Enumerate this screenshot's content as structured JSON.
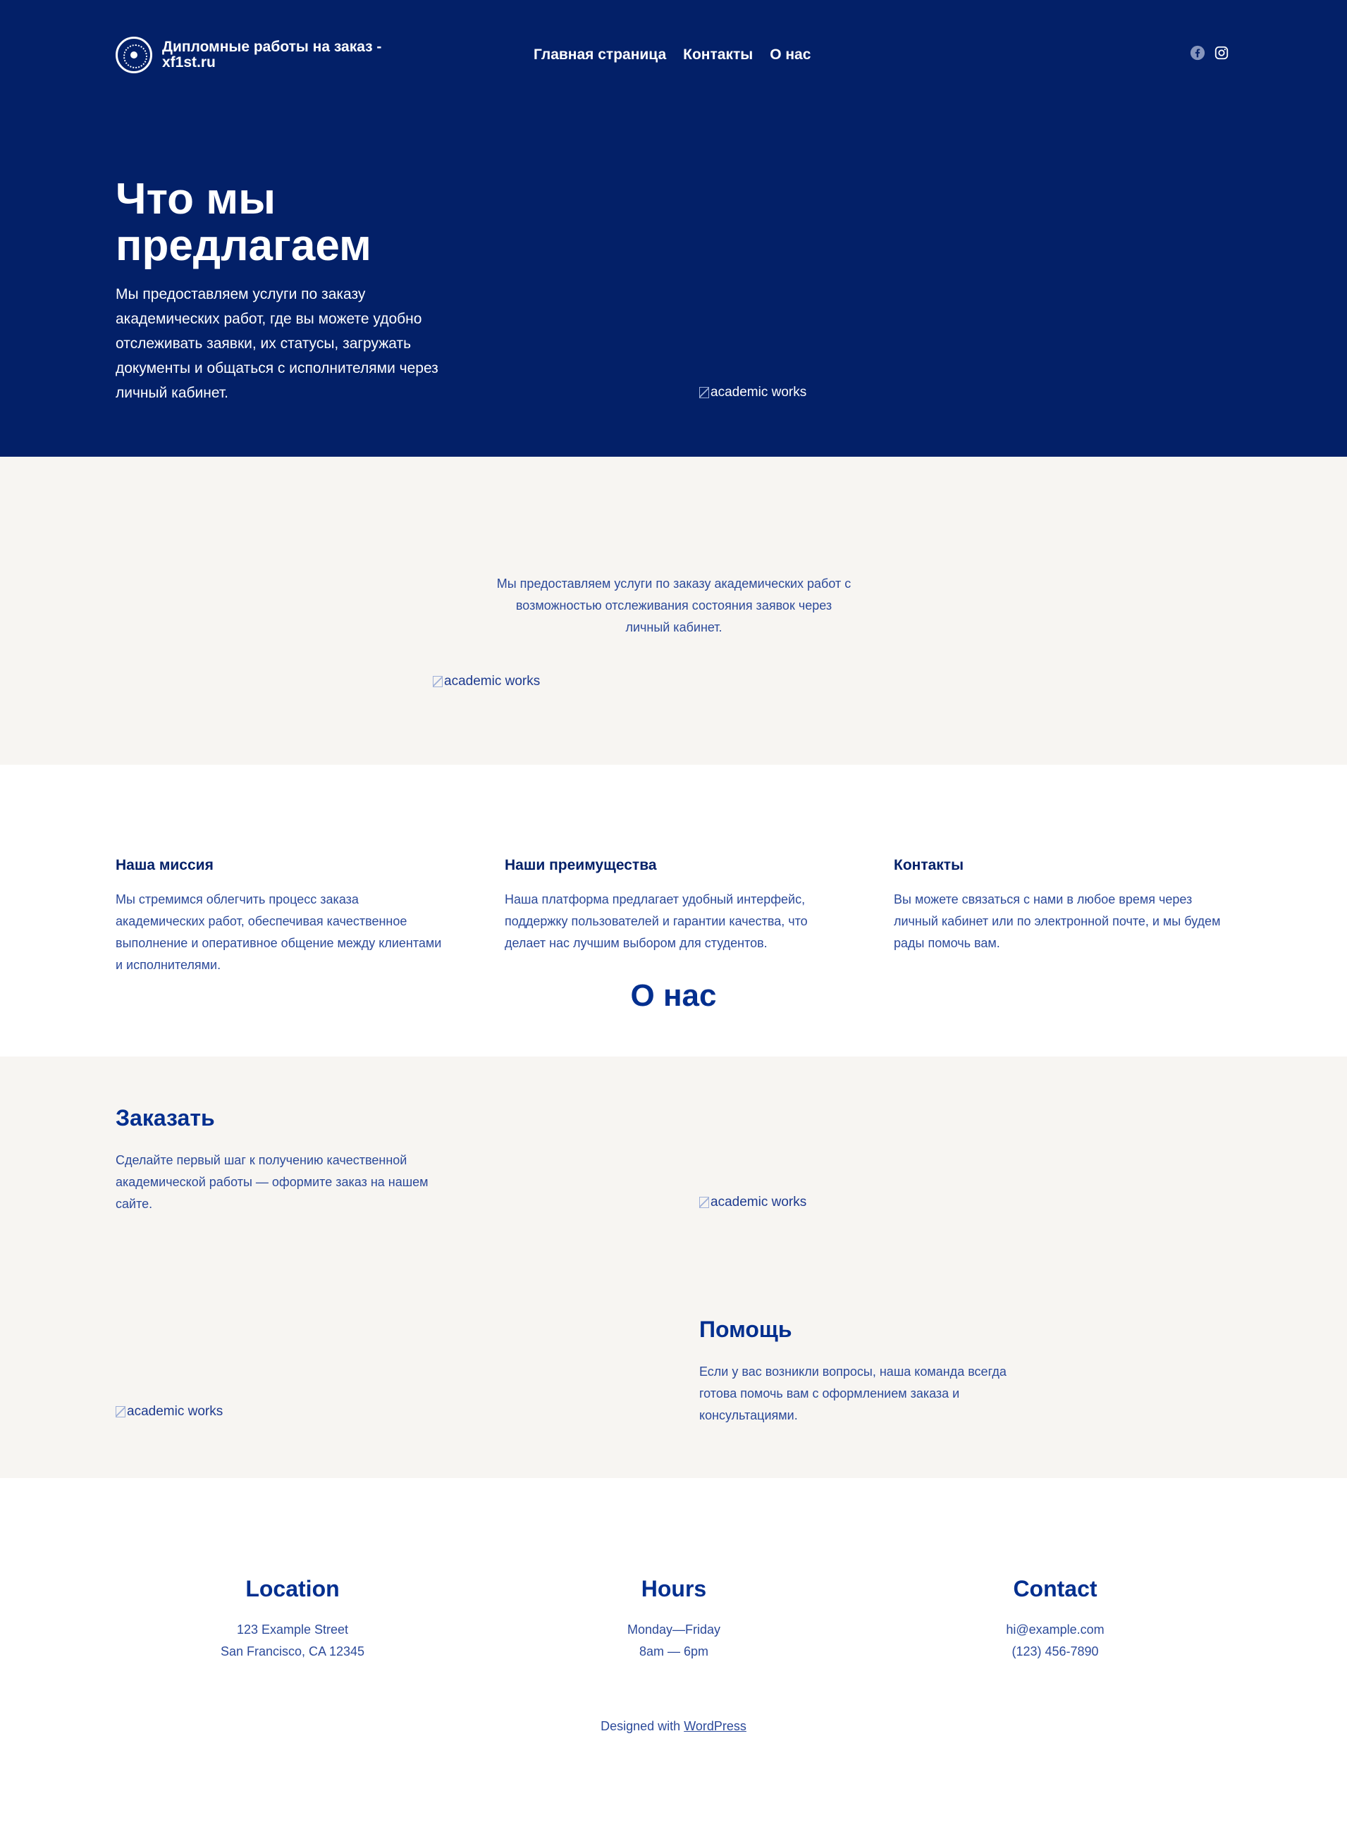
{
  "header": {
    "site_title": "Дипломные работы на заказ - xf1st.ru",
    "nav": [
      "Главная страница",
      "Контакты",
      "О нас"
    ],
    "social": [
      "facebook-icon",
      "instagram-icon"
    ]
  },
  "hero": {
    "title": "Что мы предлагаем",
    "text": "Мы предоставляем услуги по заказу академических работ, где вы можете удобно отслеживать заявки, их статусы, загружать документы и общаться с исполнителями через личный кабинет.",
    "image_alt": "academic works"
  },
  "about": {
    "title": "О нас",
    "text": "Мы предоставляем услуги по заказу академических работ с возможностью отслеживания состояния заявок через личный кабинет.",
    "image_alt": "academic works"
  },
  "features": [
    {
      "title": "Наша миссия",
      "text": "Мы стремимся облегчить процесс заказа академических работ, обеспечивая качественное выполнение и оперативное общение между клиентами и исполнителями."
    },
    {
      "title": "Наши преимущества",
      "text": "Наша платформа предлагает удобный интерфейс, поддержку пользователей и гарантии качества, что делает нас лучшим выбором для студентов."
    },
    {
      "title": "Контакты",
      "text": "Вы можете связаться с нами в любое время через личный кабинет или по электронной почте, и мы будем рады помочь вам."
    }
  ],
  "order": {
    "title": "Заказать",
    "text": "Сделайте первый шаг к получению качественной академической работы — оформите заказ на нашем сайте.",
    "image_a_alt": "academic works",
    "image_b_alt": "academic works"
  },
  "help": {
    "title": "Помощь",
    "text": "Если у вас возникли вопросы, наша команда всегда готова помочь вам с оформлением заказа и консультациями."
  },
  "footer": {
    "location": {
      "title": "Location",
      "line1": "123 Example Street",
      "line2": "San Francisco, CA 12345"
    },
    "hours": {
      "title": "Hours",
      "line1": "Monday—Friday",
      "line2": "8am — 6pm"
    },
    "contact": {
      "title": "Contact",
      "line1": "hi@example.com",
      "line2": "(123) 456-7890"
    },
    "credit_prefix": "Designed with",
    "credit_link": "WordPress"
  }
}
